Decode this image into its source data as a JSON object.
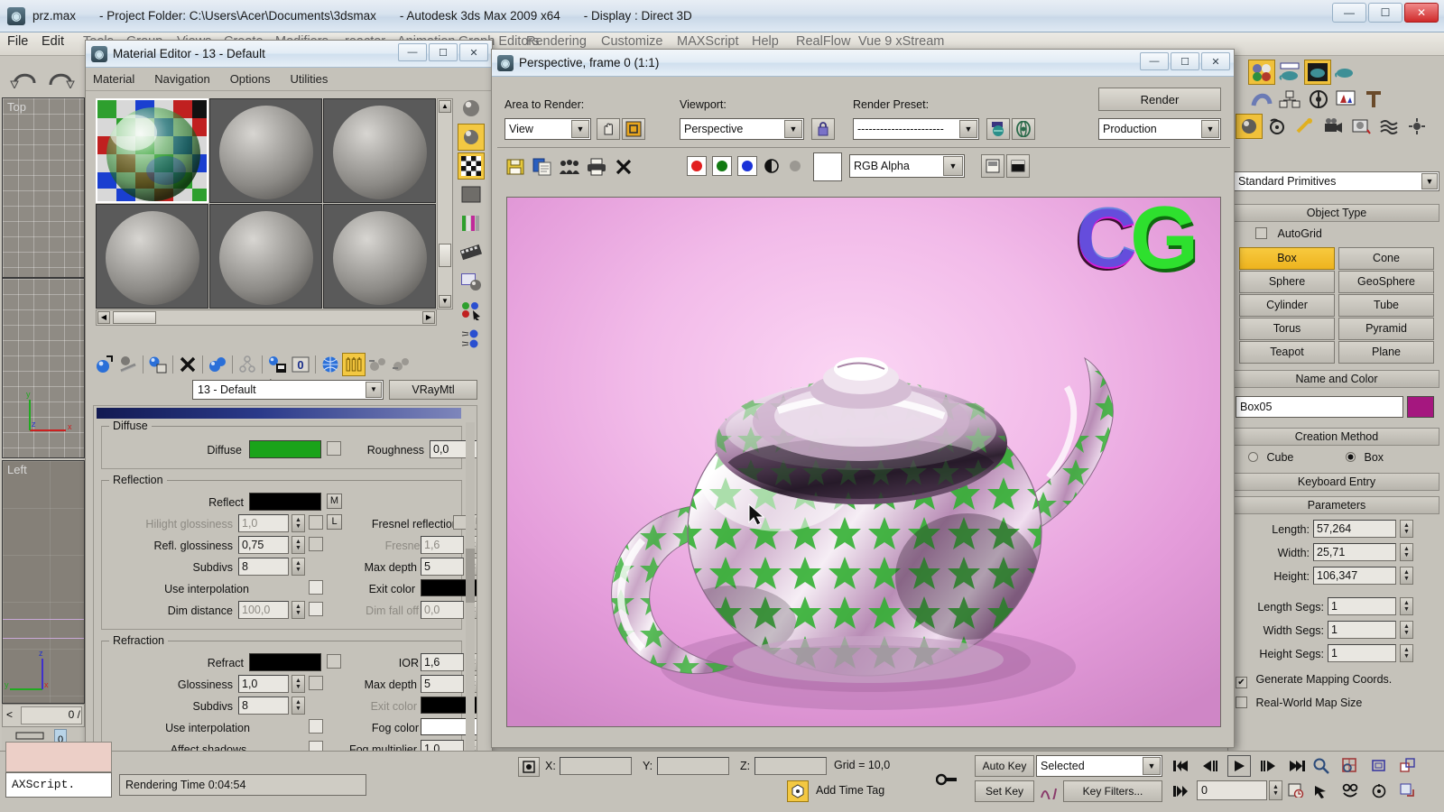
{
  "titlebar": {
    "icon": "3dsmax-logo-icon",
    "file": "prz.max",
    "project": "- Project Folder: C:\\Users\\Acer\\Documents\\3dsmax",
    "app": "- Autodesk 3ds Max  2009 x64",
    "display": "- Display : Direct 3D",
    "minimize": "—",
    "maximize": "☐",
    "close": "✕"
  },
  "menubar": {
    "items": [
      "File",
      "Edit",
      "Tools",
      "Group",
      "Views",
      "Create",
      "Modifiers",
      "reactor",
      "Animation",
      "Graph Editors",
      "Rendering",
      "Customize",
      "MAXScript",
      "Help",
      "RealFlow",
      "Vue 9 xStream"
    ]
  },
  "viewports": [
    {
      "label": "Top"
    },
    {
      "label": ""
    },
    {
      "label": "Left"
    }
  ],
  "material_editor": {
    "title": "Material Editor - 13 - Default",
    "menu": [
      "Material",
      "Navigation",
      "Options",
      "Utilities"
    ],
    "window_buttons": {
      "min": "—",
      "max": "☐",
      "close": "✕"
    },
    "slots_count": 6,
    "active_slot_index": 0,
    "material_name": "13 - Default",
    "material_type": "VRayMtl",
    "toolbar_icons": [
      "get-material-icon",
      "put-material-to-scene-icon",
      "assign-material-to-selection-icon",
      "reset-map-icon",
      "make-material-copy-icon",
      "make-unique-icon",
      "put-to-library-icon",
      "material-effects-channel-icon",
      "show-map-in-viewport-icon",
      "show-end-result-icon",
      "go-to-parent-icon",
      "go-forward-to-sibling-icon"
    ],
    "side_icons": [
      "sample-type-icon",
      "backlight-icon",
      "background-checker-icon",
      "sample-uv-tiling-icon",
      "video-color-check-icon",
      "make-preview-icon",
      "options-icon",
      "select-by-material-icon",
      "material-map-navigator-icon"
    ],
    "groups": {
      "diffuse": {
        "title": "Diffuse",
        "fields": [
          {
            "label": "Diffuse",
            "type": "color",
            "value": "#1aa31a"
          },
          {
            "label": "Roughness",
            "type": "number",
            "value": "0,0"
          }
        ]
      },
      "reflection": {
        "title": "Reflection",
        "fields": [
          {
            "label": "Reflect",
            "type": "color",
            "value": "#000000",
            "map_button": "M"
          },
          {
            "label": "Hilight glossiness",
            "type": "number",
            "value": "1,0",
            "disabled": true,
            "lock": "L"
          },
          {
            "label": "Fresnel reflections",
            "type": "checkbox",
            "value": false,
            "lock": "L"
          },
          {
            "label": "Refl. glossiness",
            "type": "number",
            "value": "0,75"
          },
          {
            "label": "Fresnel IOR",
            "type": "number",
            "value": "1,6",
            "disabled": true
          },
          {
            "label": "Subdivs",
            "type": "number",
            "value": "8"
          },
          {
            "label": "Max depth",
            "type": "number",
            "value": "5"
          },
          {
            "label": "Use interpolation",
            "type": "checkbox",
            "value": false
          },
          {
            "label": "Exit color",
            "type": "color",
            "value": "#000000"
          },
          {
            "label": "Dim distance",
            "type": "number",
            "value": "100,0",
            "disabled": true
          },
          {
            "label": "Dim fall off",
            "type": "number",
            "value": "0,0",
            "disabled": true
          }
        ]
      },
      "refraction": {
        "title": "Refraction",
        "fields": [
          {
            "label": "Refract",
            "type": "color",
            "value": "#000000"
          },
          {
            "label": "IOR",
            "type": "number",
            "value": "1,6"
          },
          {
            "label": "Glossiness",
            "type": "number",
            "value": "1,0"
          },
          {
            "label": "Max depth",
            "type": "number",
            "value": "5"
          },
          {
            "label": "Subdivs",
            "type": "number",
            "value": "8"
          },
          {
            "label": "Exit color",
            "type": "color",
            "value": "#000000",
            "disabled": true
          },
          {
            "label": "Use interpolation",
            "type": "checkbox",
            "value": false
          },
          {
            "label": "Fog color",
            "type": "color",
            "value": "#ffffff"
          },
          {
            "label": "Affect shadows",
            "type": "checkbox",
            "value": false
          },
          {
            "label": "Fog multiplier",
            "type": "number",
            "value": "1,0"
          }
        ]
      }
    }
  },
  "render_frame": {
    "title": "Perspective, frame 0 (1:1)",
    "window_buttons": {
      "min": "—",
      "max": "☐",
      "close": "✕"
    },
    "area_to_render": {
      "label": "Area to Render:",
      "value": "View"
    },
    "viewport": {
      "label": "Viewport:",
      "value": "Perspective",
      "locked": true
    },
    "render_preset": {
      "label": "Render Preset:",
      "value": "-----------------------"
    },
    "render_button": "Render",
    "render_mode": "Production",
    "toolbar_icons": [
      "save-bitmap-icon",
      "clone-rendered-frame-icon",
      "print-image-icon",
      "print-icon",
      "clear-icon"
    ],
    "channels": [
      {
        "name": "red-channel-icon",
        "color": "#e21e1e"
      },
      {
        "name": "green-channel-icon",
        "color": "#127a12"
      },
      {
        "name": "blue-channel-icon",
        "color": "#1a32d8"
      },
      {
        "name": "monochrome-icon",
        "color": "#111111"
      },
      {
        "name": "alpha-channel-icon",
        "color": "#8a8a8a"
      }
    ],
    "swatch_color": "#ffffff",
    "channel_select": "RGB Alpha",
    "watermark": {
      "c": "C",
      "g": "G"
    }
  },
  "command_panel": {
    "tab_icons": [
      "create-tab-icon",
      "modify-tab-icon",
      "hierarchy-tab-icon",
      "motion-tab-icon",
      "display-tab-icon",
      "utilities-tab-icon"
    ],
    "create_icons": [
      "geometry-icon",
      "shapes-icon",
      "lights-icon",
      "cameras-icon",
      "helpers-icon",
      "space-warps-icon",
      "systems-icon"
    ],
    "category": "Standard Primitives",
    "object_type": {
      "title": "Object Type",
      "autogrid": {
        "label": "AutoGrid",
        "checked": false
      },
      "buttons": [
        "Box",
        "Cone",
        "Sphere",
        "GeoSphere",
        "Cylinder",
        "Tube",
        "Torus",
        "Pyramid",
        "Teapot",
        "Plane"
      ],
      "selected": "Box"
    },
    "name_and_color": {
      "title": "Name and Color",
      "name": "Box05",
      "color": "#a5177f"
    },
    "creation_method": {
      "title": "Creation Method",
      "options": [
        "Cube",
        "Box"
      ],
      "selected": "Box"
    },
    "keyboard_entry": "Keyboard Entry",
    "parameters": {
      "title": "Parameters",
      "fields": [
        {
          "label": "Length:",
          "value": "57,264"
        },
        {
          "label": "Width:",
          "value": "25,71"
        },
        {
          "label": "Height:",
          "value": "106,347"
        },
        {
          "label": "Length Segs:",
          "value": "1"
        },
        {
          "label": "Width Segs:",
          "value": "1"
        },
        {
          "label": "Height Segs:",
          "value": "1"
        }
      ],
      "checkboxes": [
        {
          "label": "Generate Mapping Coords.",
          "checked": true
        },
        {
          "label": "Real-World Map Size",
          "checked": false
        }
      ]
    }
  },
  "status_bar": {
    "maxscript_label": "AXScript.",
    "prompt": "Rendering Time  0:04:54",
    "coords": [
      {
        "label": "X:",
        "value": ""
      },
      {
        "label": "Y:",
        "value": ""
      },
      {
        "label": "Z:",
        "value": ""
      }
    ],
    "grid": "Grid = 10,0",
    "add_time_tag": "Add Time Tag",
    "auto_key": "Auto Key",
    "set_key": "Set Key",
    "key_mode": "Selected",
    "key_filters": "Key Filters...",
    "frame_value": "0",
    "frame_left": "0",
    "timebar_value": "0",
    "nav_icons": [
      "zoom-icon",
      "zoom-all-icon",
      "zoom-extents-icon",
      "zoom-region-icon",
      "pan-icon",
      "arc-rotate-icon",
      "field-of-view-icon",
      "maximize-viewport-icon"
    ],
    "playback_icons": [
      "go-to-start-icon",
      "previous-frame-icon",
      "play-animation-icon",
      "next-frame-icon",
      "go-to-end-icon"
    ]
  }
}
